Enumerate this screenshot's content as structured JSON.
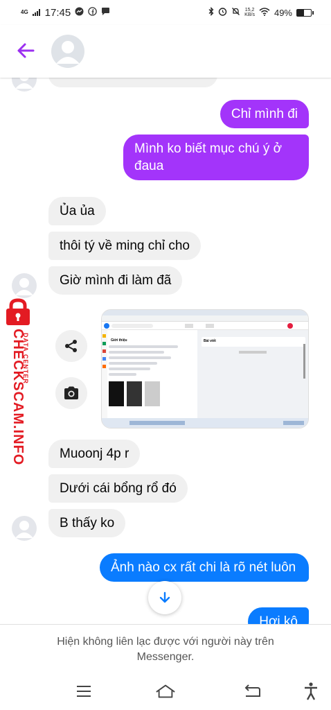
{
  "status_bar": {
    "network": "4G",
    "time": "17:45",
    "speed_value": "15,2",
    "speed_unit": "KB/s",
    "battery": "49%",
    "battery_level": 0.49
  },
  "header": {
    "back_icon": "arrow-left-icon",
    "accent": "#9b2ff0"
  },
  "messages": {
    "partial_top": "",
    "out_1": "Chỉ mình đi",
    "out_2": "Mình ko biết mục chú ý ở đaua",
    "in_1": "Ủa ủa",
    "in_2": "thôi tý về ming chỉ cho",
    "in_3": "Giờ mình đi làm đã",
    "in_4": "Muoonj 4p r",
    "in_5": "Dưới cái bổng rổ đó",
    "in_6": "B thấy ko",
    "out_3": "Ảnh nào cx rất chi là rõ nét luôn",
    "out_4": "Hơi kô"
  },
  "image_message": {
    "share_icon": "share-icon",
    "camera_icon": "camera-icon",
    "thumbnail_text_left_title": "Giới thiệu",
    "thumbnail_text_right_title": "Bài viết"
  },
  "watermark": {
    "main": "CHECKSCAM.INFO",
    "sub": "DATA CENTER",
    "color": "#e31b23"
  },
  "footer": {
    "notice": "Hiện không liên lạc được với người này trên Messenger."
  },
  "navbar": {
    "menu_icon": "menu-icon",
    "home_icon": "home-icon",
    "back_icon": "back-icon",
    "accessibility_icon": "accessibility-icon"
  },
  "colors": {
    "outgoing_purple": "#a334fa",
    "outgoing_blue": "#0a7cff",
    "incoming": "#f0f0f0"
  }
}
